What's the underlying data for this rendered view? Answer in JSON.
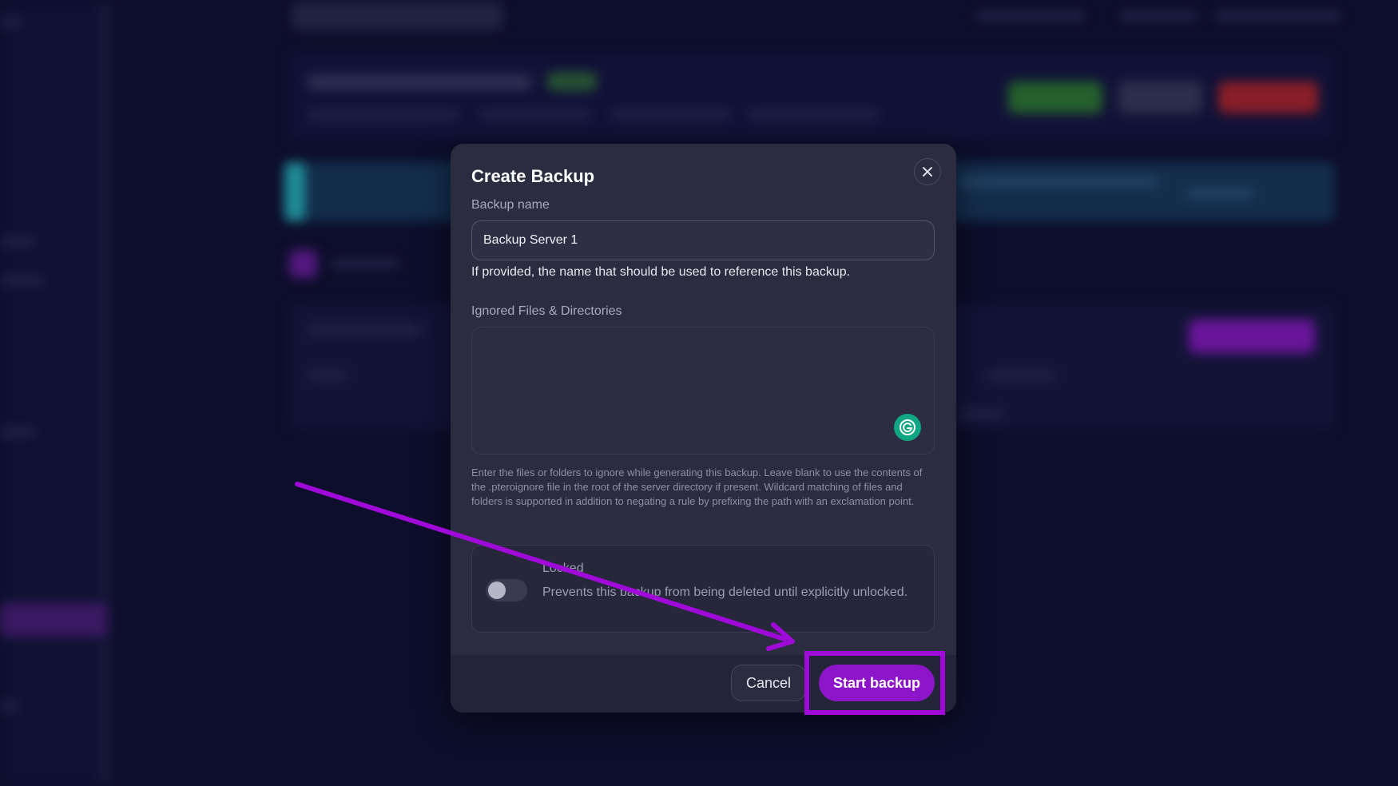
{
  "modal": {
    "title": "Create Backup",
    "backup_name_label": "Backup name",
    "backup_name_value": "Backup Server 1",
    "backup_name_help": "If provided, the name that should be used to reference this backup.",
    "ignored_label": "Ignored Files & Directories",
    "ignored_value": "",
    "ignored_help": "Enter the files or folders to ignore while generating this backup. Leave blank to use the contents of the .pteroignore file in the root of the server directory if present. Wildcard matching of files and folders is supported in addition to negating a rule by prefixing the path with an exclamation point.",
    "locked_label": "Locked",
    "locked_desc": "Prevents this backup from being deleted until explicitly unlocked.",
    "locked_on": false,
    "cancel_label": "Cancel",
    "start_label": "Start backup"
  },
  "icons": {
    "close": "close-icon",
    "grammarly": "grammarly-icon"
  },
  "colors": {
    "accent": "#8d15c9",
    "annotation": "#a00ad8",
    "modal_bg": "#2b2c3f",
    "page_bg": "#0f1030"
  }
}
